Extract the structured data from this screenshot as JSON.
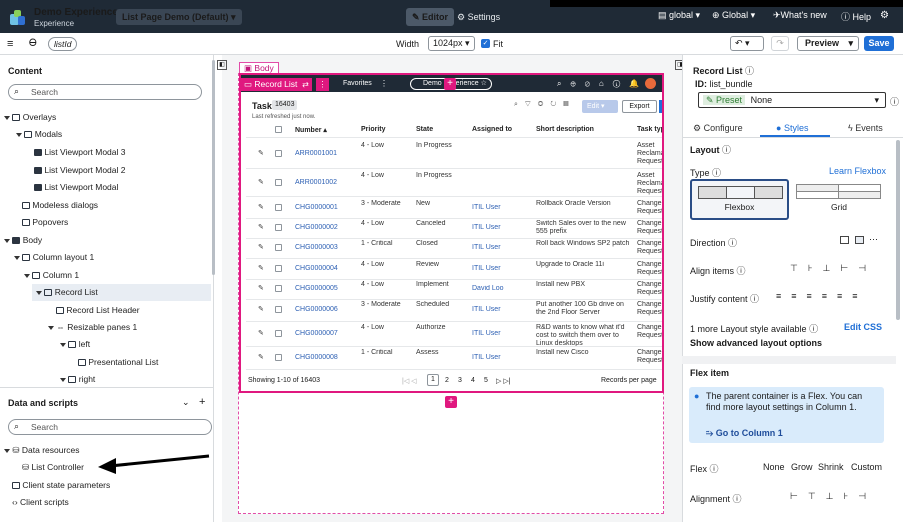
{
  "topbar": {
    "app_name": "Demo Experience",
    "app_sub": "Experience",
    "page_select": "List Page Demo (Default)",
    "editor": "Editor",
    "settings": "Settings",
    "scope_global_icon": "global",
    "scope_global_dd": "Global",
    "whats_new": "What's new",
    "help": "Help"
  },
  "secondbar": {
    "param": "listId",
    "width_label": "Width",
    "width_value": "1024px",
    "fit_label": "Fit",
    "preview": "Preview",
    "save": "Save"
  },
  "content": {
    "title": "Content",
    "search_placeholder": "Search",
    "tree": [
      "Overlays",
      "Modals",
      "List Viewport Modal 3",
      "List Viewport Modal 2",
      "List Viewport Modal",
      "Modeless dialogs",
      "Popovers",
      "Body",
      "Column layout 1",
      "Column 1",
      "Record List",
      "Record List Header",
      "Resizable panes 1",
      "left",
      "Presentational List",
      "right"
    ]
  },
  "data_scripts": {
    "title": "Data and scripts",
    "search_placeholder": "Search",
    "items": [
      "Data resources",
      "List Controller",
      "Client state parameters",
      "Client scripts"
    ]
  },
  "canvas": {
    "body_tag": "Body",
    "rl_tag": "Record List",
    "favorites": "Favorites",
    "demo_pill": "Demo Experience",
    "list_title": "Task",
    "list_count": "16403",
    "refreshed": "Last refreshed just now.",
    "edit": "Edit",
    "export": "Export",
    "headers": [
      "Number",
      "Priority",
      "State",
      "Assigned to",
      "Short description",
      "Task type"
    ],
    "rows": [
      [
        "ARR0001001",
        "4 - Low",
        "In Progress",
        "",
        "",
        "Asset Reclamation Request"
      ],
      [
        "ARR0001002",
        "4 - Low",
        "In Progress",
        "",
        "",
        "Asset Reclamation Request"
      ],
      [
        "CHG0000001",
        "3 - Moderate",
        "New",
        "ITIL User",
        "Rollback Oracle Version",
        "Change Request"
      ],
      [
        "CHG0000002",
        "4 - Low",
        "Canceled",
        "ITIL User",
        "Switch Sales over to the new 555 prefix",
        "Change Request"
      ],
      [
        "CHG0000003",
        "1 - Critical",
        "Closed",
        "ITIL User",
        "Roll back Windows SP2 patch",
        "Change Request"
      ],
      [
        "CHG0000004",
        "4 - Low",
        "Review",
        "ITIL User",
        "Upgrade to Oracle 11i",
        "Change Request"
      ],
      [
        "CHG0000005",
        "4 - Low",
        "Implement",
        "David Loo",
        "Install new PBX",
        "Change Request"
      ],
      [
        "CHG0000006",
        "3 - Moderate",
        "Scheduled",
        "ITIL User",
        "Put another 100 Gb drive on the 2nd Floor Server",
        "Change Request"
      ],
      [
        "CHG0000007",
        "4 - Low",
        "Authorize",
        "ITIL User",
        "R&D wants to know what it'd cost to switch them over to Linux desktops",
        "Change Request"
      ],
      [
        "CHG0000008",
        "1 - Critical",
        "Assess",
        "ITIL User",
        "Install new Cisco",
        "Change Request"
      ]
    ],
    "showing": "Showing 1-10 of 16403",
    "pages": [
      "1",
      "2",
      "3",
      "4",
      "5"
    ],
    "records_per_page": "Records per page"
  },
  "props": {
    "title": "Record List",
    "id_label": "ID:",
    "id_value": "list_bundle",
    "preset_label": "Preset",
    "preset_value": "None",
    "tabs": [
      "Configure",
      "Styles",
      "Events"
    ],
    "layout": "Layout",
    "type": "Type",
    "learn": "Learn Flexbox",
    "flexbox": "Flexbox",
    "grid": "Grid",
    "direction": "Direction",
    "align_items": "Align items",
    "justify": "Justify content",
    "more_style": "1 more Layout style available",
    "edit_css": "Edit CSS",
    "show_adv": "Show advanced layout options",
    "flex_item": "Flex item",
    "info": "The parent container is a Flex. You can find more layout settings in Column 1.",
    "goto": "Go to Column 1",
    "flex": "Flex",
    "flex_opts": [
      "None",
      "Grow",
      "Shrink",
      "Custom"
    ],
    "alignment": "Alignment"
  },
  "colors": {
    "topbar": "#1f2a36",
    "accent": "#e0187f",
    "link": "#2c5fb3",
    "save": "#1f6fd6"
  }
}
